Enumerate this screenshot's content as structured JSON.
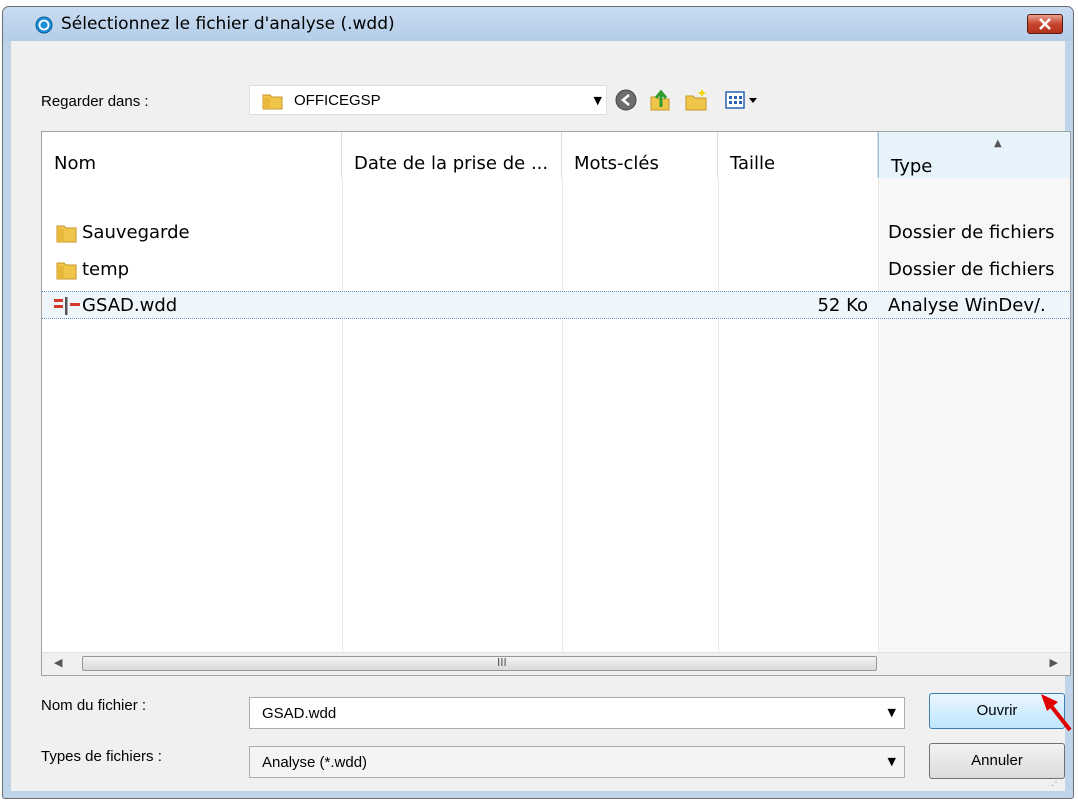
{
  "dialog": {
    "title": "Sélectionnez le fichier d'analyse (.wdd)",
    "look_in_label": "Regarder dans :",
    "look_in_value": "OFFICEGSP",
    "columns": [
      "Nom",
      "Date de la prise de ...",
      "Mots-clés",
      "Taille",
      "Type"
    ],
    "files": [
      {
        "name": "Sauvegarde",
        "date": "",
        "keywords": "",
        "size": "",
        "type": "Dossier de fichiers",
        "icon": "folder-icon"
      },
      {
        "name": "temp",
        "date": "",
        "keywords": "",
        "size": "",
        "type": "Dossier de fichiers",
        "icon": "folder-icon"
      },
      {
        "name": "GSAD.wdd",
        "date": "",
        "keywords": "",
        "size": "52 Ko",
        "type": "Analyse WinDev/.",
        "icon": "wdd-file-icon",
        "selected": true
      }
    ],
    "scroll_grip": "III",
    "filename_label": "Nom du fichier :",
    "filename_value": "GSAD.wdd",
    "filetype_label": "Types de fichiers :",
    "filetype_value": "Analyse (*.wdd)",
    "open_button": "Ouvrir",
    "cancel_button": "Annuler"
  },
  "colors": {
    "title_bar": "#b9d1ea",
    "close_button": "#c8452e",
    "selection": "#eef5fb",
    "annotation_arrow": "#e00000"
  }
}
